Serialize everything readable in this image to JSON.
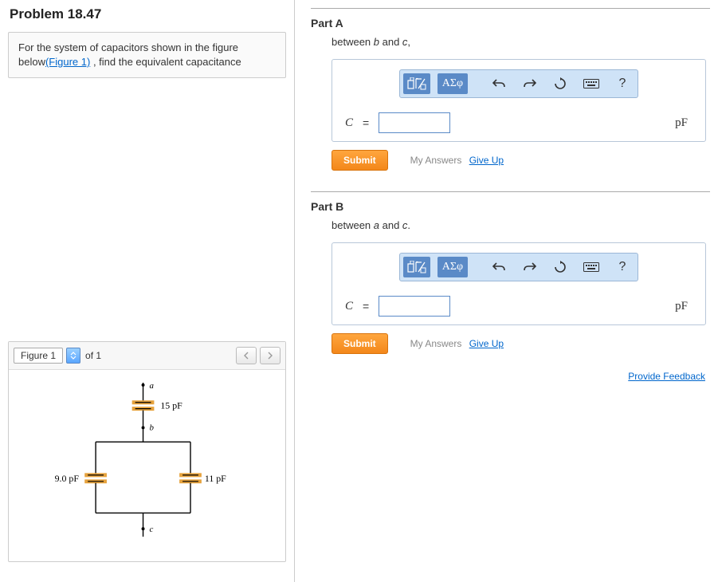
{
  "problem": {
    "title": "Problem 18.47",
    "prompt_pre": "For the system of capacitors shown in the figure below",
    "figure_link": "(Figure 1)",
    "prompt_post": " , find the equivalent capacitance"
  },
  "figure": {
    "label": "Figure 1",
    "page_of": "of 1",
    "cap_top": {
      "value": "15 pF",
      "node_top": "a",
      "node_bottom": "b"
    },
    "cap_left": {
      "value": "9.0 pF"
    },
    "cap_right": {
      "value": "11 pF"
    },
    "node_bottom": "c"
  },
  "parts": {
    "A": {
      "title": "Part A",
      "prompt_pre": "between ",
      "n1": "b",
      "and": " and ",
      "n2": "c",
      "sep": ","
    },
    "B": {
      "title": "Part B",
      "prompt_pre": "between ",
      "n1": "a",
      "and": " and ",
      "n2": "c",
      "sep": "."
    }
  },
  "answer": {
    "var": "C",
    "eq": "=",
    "unit": "pF"
  },
  "toolbar": {
    "greek": "ΑΣφ",
    "help": "?"
  },
  "submit": {
    "label": "Submit",
    "my": "My Answers",
    "giveup": "Give Up"
  },
  "feedback": "Provide Feedback"
}
